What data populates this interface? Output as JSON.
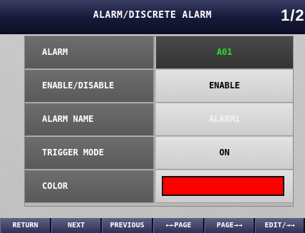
{
  "header": {
    "title": "ALARM/DISCRETE ALARM",
    "page": "1/2"
  },
  "rows": [
    {
      "label": "ALARM",
      "value": "A01"
    },
    {
      "label": "ENABLE/DISABLE",
      "value": "ENABLE"
    },
    {
      "label": "ALARM NAME",
      "value": "ALARM1"
    },
    {
      "label": "TRIGGER MODE",
      "value": "ON"
    },
    {
      "label": "COLOR",
      "value": ""
    }
  ],
  "colors": {
    "alarm_value": "#27e02b",
    "color_swatch": "#ff0000",
    "alarm_name_text": "#f2f2f2"
  },
  "footer": {
    "buttons": [
      "RETURN",
      "NEXT",
      "PREVIOUS",
      "←←PAGE",
      "PAGE→→",
      "EDIT/→→"
    ]
  }
}
